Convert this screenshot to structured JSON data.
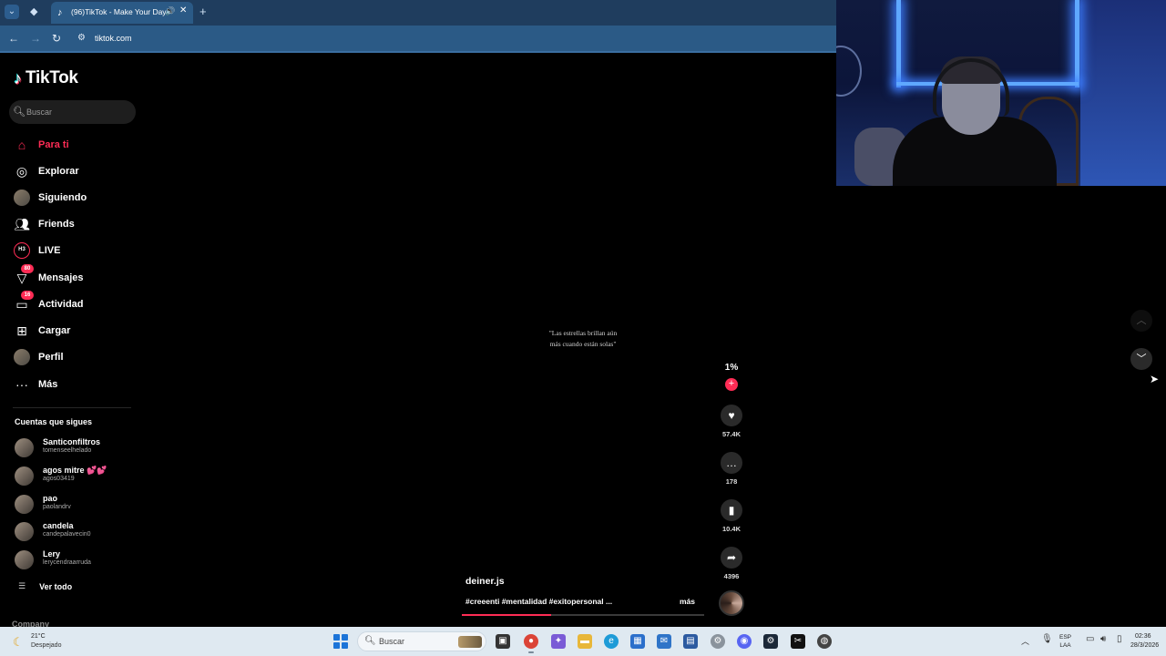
{
  "browser": {
    "tab_title": "(96)TikTok - Make Your Day",
    "url": "tiktok.com"
  },
  "colors": {
    "tiktok_accent": "#fe2c55",
    "tab_bar": "#1f3d5e",
    "address_bar": "#2b5a86"
  },
  "sidebar": {
    "logo_text": "TikTok",
    "search_placeholder": "Buscar",
    "nav": [
      {
        "label": "Para ti",
        "icon": "home-icon",
        "active": true
      },
      {
        "label": "Explorar",
        "icon": "compass-icon"
      },
      {
        "label": "Siguiendo",
        "icon": "following-avatar-icon"
      },
      {
        "label": "Friends",
        "icon": "friends-icon"
      },
      {
        "label": "LIVE",
        "icon": "live-icon"
      },
      {
        "label": "Mensajes",
        "icon": "messages-icon",
        "badge": "80"
      },
      {
        "label": "Actividad",
        "icon": "activity-icon",
        "badge": "16"
      },
      {
        "label": "Cargar",
        "icon": "upload-icon"
      },
      {
        "label": "Perfil",
        "icon": "profile-avatar-icon"
      },
      {
        "label": "Más",
        "icon": "more-icon"
      }
    ],
    "following_title": "Cuentas que sigues",
    "accounts": [
      {
        "name": "Santiconfiltros",
        "handle": "tomenseelhelado"
      },
      {
        "name": "agos mitre 💕💕",
        "handle": "agos03419"
      },
      {
        "name": "pao",
        "handle": "paolandrv"
      },
      {
        "name": "candela",
        "handle": "candepalavecin0"
      },
      {
        "name": "Lery",
        "handle": "lerycendraarruda"
      }
    ],
    "see_all": "Ver todo",
    "company": "Company"
  },
  "video": {
    "caption": "\"Las estrellas brillan aún\nmás cuando están solas\"",
    "author": "deiner.js",
    "description": "#creeenti #mentalidad #exitopersonal ...",
    "more": "más",
    "progress": 0.37
  },
  "actions": {
    "creator_label": "1%",
    "likes": "57.4K",
    "comments": "178",
    "saves": "10.4K",
    "shares": "4396"
  },
  "taskbar": {
    "weather_temp": "21°C",
    "weather_desc": "Despejado",
    "search_label": "Buscar",
    "lang_line1": "ESP",
    "lang_line2": "LAA",
    "time": "02:36",
    "date": "28/3/2026"
  }
}
